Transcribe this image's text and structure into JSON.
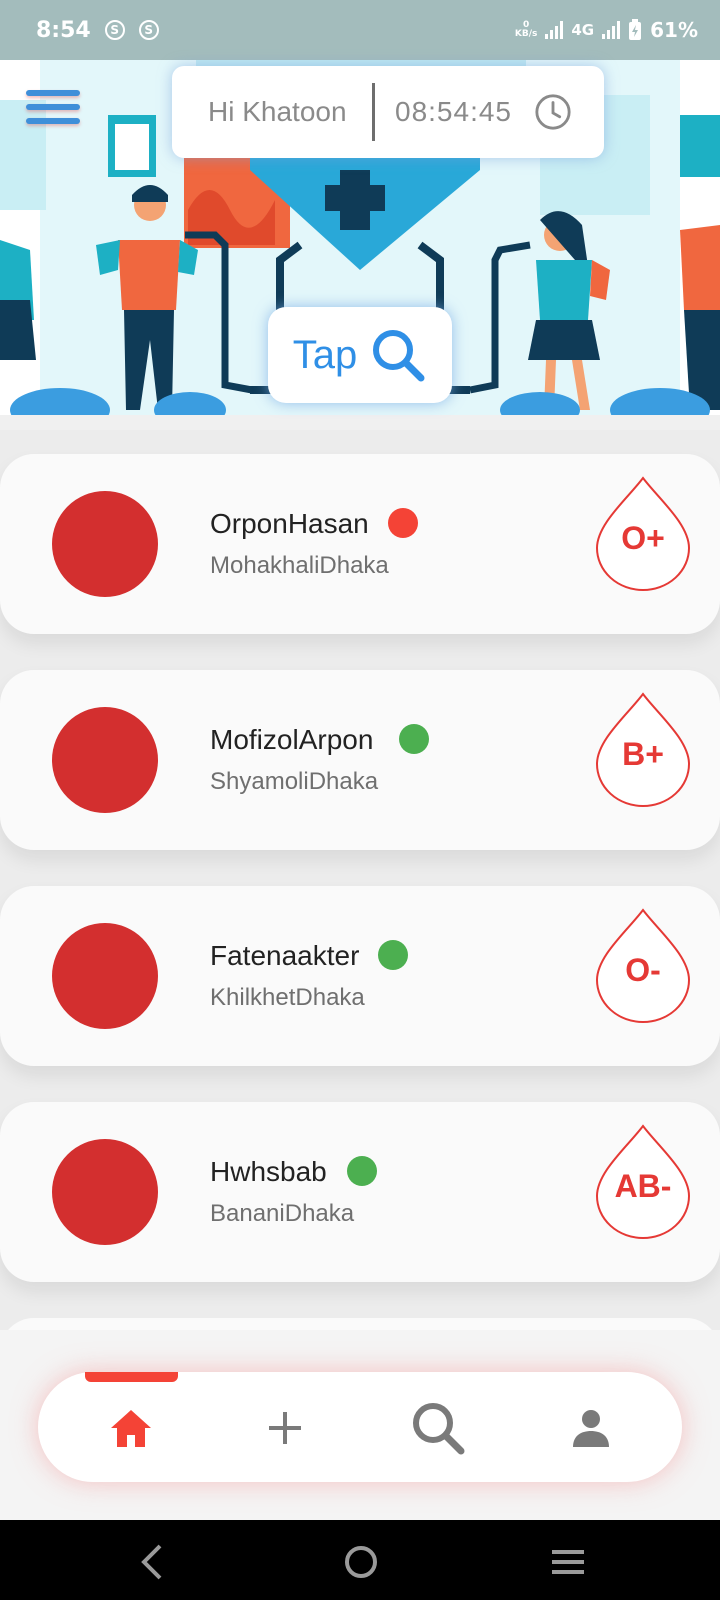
{
  "status_bar": {
    "time": "8:54",
    "sync_icons": [
      "S",
      "S"
    ],
    "data_speed_value": "0",
    "data_speed_unit": "KB/s",
    "network": "4G",
    "battery": "61%"
  },
  "header": {
    "greeting": "Hi Khatoon",
    "clock": "08:54:45",
    "tap_label": "Tap"
  },
  "donors": [
    {
      "name": "OrponHasan",
      "location": "MohakhaliDhaka",
      "blood_group": "O+",
      "status_color": "#f44336"
    },
    {
      "name": "MofizolArpon",
      "location": "ShyamoliDhaka",
      "blood_group": "B+",
      "status_color": "#4caf50"
    },
    {
      "name": "Fatenaakter",
      "location": "KhilkhetDhaka",
      "blood_group": "O-",
      "status_color": "#4caf50"
    },
    {
      "name": "Hwhsbab",
      "location": "BananiDhaka",
      "blood_group": "AB-",
      "status_color": "#4caf50"
    }
  ],
  "bottom_nav": {
    "items": [
      "home-icon",
      "add-icon",
      "search-icon",
      "profile-icon"
    ],
    "active_index": 0,
    "active_color": "#f44336",
    "inactive_color": "#7a7a7a"
  },
  "system_nav": [
    "back-icon",
    "home-circle-icon",
    "recents-icon"
  ],
  "colors": {
    "primary_red": "#d32f2f",
    "accent_blue": "#2f8fe6",
    "online": "#4caf50",
    "offline": "#f44336"
  }
}
